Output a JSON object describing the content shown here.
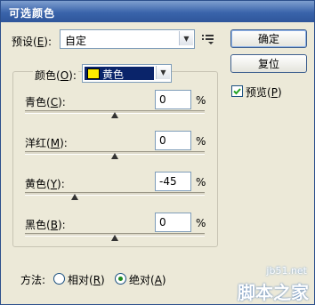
{
  "window": {
    "title": "可选颜色"
  },
  "preset": {
    "label": "预设(",
    "accel": "E",
    "suffix": "):",
    "value": "自定"
  },
  "buttons": {
    "ok": "确定",
    "reset": "复位"
  },
  "preview": {
    "label_pre": "预览(",
    "accel": "P",
    "suffix": ")",
    "checked": true
  },
  "colors": {
    "label": "颜色(",
    "accel": "O",
    "suffix": "):",
    "selected": "黄色",
    "swatch_color": "#ffee00",
    "select_bg": "#0a246a"
  },
  "sliders": [
    {
      "name": "青色",
      "accel": "C",
      "value": "0",
      "unit": "%",
      "fraction": 0.5
    },
    {
      "name": "洋红",
      "accel": "M",
      "value": "0",
      "unit": "%",
      "fraction": 0.5
    },
    {
      "name": "黄色",
      "accel": "Y",
      "value": "-45",
      "unit": "%",
      "fraction": 0.275
    },
    {
      "name": "黑色",
      "accel": "B",
      "value": "0",
      "unit": "%",
      "fraction": 0.5
    }
  ],
  "method": {
    "label": "方法:",
    "options": [
      {
        "label": "相对(",
        "accel": "R",
        "suffix": ")",
        "checked": false
      },
      {
        "label": "绝对(",
        "accel": "A",
        "suffix": ")",
        "checked": true
      }
    ]
  },
  "watermark": {
    "site": "jb51.net",
    "brand": "脚本之家"
  }
}
